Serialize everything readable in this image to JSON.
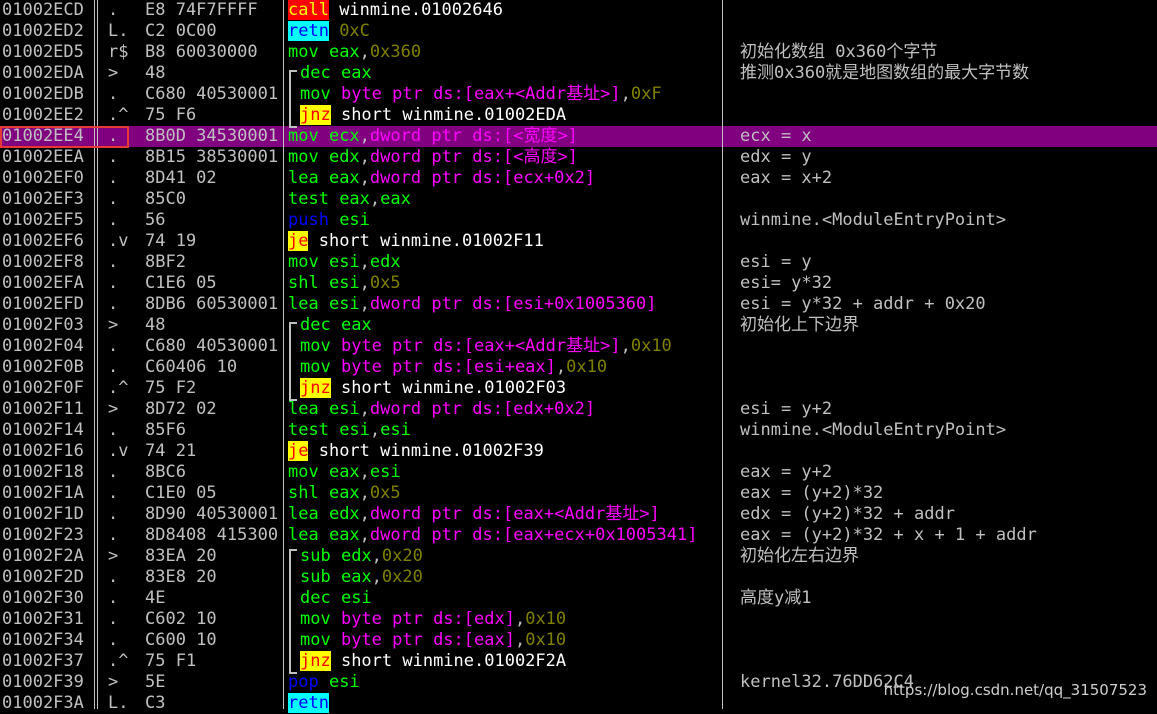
{
  "colors": {
    "default": "#c0c0c0",
    "mnemonic": "#00ff00",
    "operand_reg": "#00ff00",
    "sep": "#c0c0c0",
    "mem": "#ff00ff",
    "imm": "#808000",
    "text": "#ffffff",
    "call_bg": "#ff0000",
    "call_fg": "#ffff00",
    "retn_bg": "#00ffff",
    "retn_fg": "#0000ff",
    "jcc_bg": "#ffff00",
    "jcc_fg": "#ff0000",
    "stack_fg": "#0000ff",
    "selected_bg": "#800080",
    "selected_box": "#e53935"
  },
  "rows": [
    {
      "addr": "01002ECD",
      "flow": ".",
      "hex": "E8 74F7FFFF",
      "asm": [
        {
          "t": "call",
          "s": "call"
        },
        {
          "t": " winmine.01002646",
          "s": "text"
        }
      ],
      "cmt": ""
    },
    {
      "addr": "01002ED2",
      "flow": "L.",
      "hex": "C2 0C00",
      "asm": [
        {
          "t": "retn",
          "s": "retn"
        },
        {
          "t": " 0xC",
          "s": "imm"
        }
      ],
      "cmt": ""
    },
    {
      "addr": "01002ED5",
      "flow": "r$",
      "hex": "B8 60030000",
      "asm": [
        {
          "t": "mov ",
          "s": "mn"
        },
        {
          "t": "eax",
          "s": "reg"
        },
        {
          "t": ",",
          "s": "sep"
        },
        {
          "t": "0x360",
          "s": "imm"
        }
      ],
      "cmt": "初始化数组 0x360个字节"
    },
    {
      "addr": "01002EDA",
      "flow": ">",
      "hex": "48",
      "asm": [
        {
          "t": "dec ",
          "s": "mn"
        },
        {
          "t": "eax",
          "s": "reg"
        }
      ],
      "cmt": "推测0x360就是地图数组的最大字节数"
    },
    {
      "addr": "01002EDB",
      "flow": ".",
      "hex": "C680 40530001",
      "asm": [
        {
          "t": "mov ",
          "s": "mn"
        },
        {
          "t": "byte ptr ds:[eax+<Addr基址>]",
          "s": "mem"
        },
        {
          "t": ",",
          "s": "sep"
        },
        {
          "t": "0xF",
          "s": "imm"
        }
      ],
      "cmt": ""
    },
    {
      "addr": "01002EE2",
      "flow": ".^",
      "hex": "75 F6",
      "asm": [
        {
          "t": "jnz",
          "s": "jcc"
        },
        {
          "t": " short winmine.01002EDA",
          "s": "text"
        }
      ],
      "cmt": ""
    },
    {
      "addr": "01002EE4",
      "flow": ".",
      "hex": "8B0D 34530001",
      "asm": [
        {
          "t": "mov ",
          "s": "mn"
        },
        {
          "t": "ecx",
          "s": "reg"
        },
        {
          "t": ",",
          "s": "sep"
        },
        {
          "t": "dword ptr ds:[<宽度>]",
          "s": "mem"
        }
      ],
      "cmt": "ecx = x",
      "selected": true
    },
    {
      "addr": "01002EEA",
      "flow": ".",
      "hex": "8B15 38530001",
      "asm": [
        {
          "t": "mov ",
          "s": "mn"
        },
        {
          "t": "edx",
          "s": "reg"
        },
        {
          "t": ",",
          "s": "sep"
        },
        {
          "t": "dword ptr ds:[<高度>]",
          "s": "mem"
        }
      ],
      "cmt": "edx = y"
    },
    {
      "addr": "01002EF0",
      "flow": ".",
      "hex": "8D41 02",
      "asm": [
        {
          "t": "lea ",
          "s": "mn"
        },
        {
          "t": "eax",
          "s": "reg"
        },
        {
          "t": ",",
          "s": "sep"
        },
        {
          "t": "dword ptr ds:[ecx+0x2]",
          "s": "mem"
        }
      ],
      "cmt": "eax = x+2"
    },
    {
      "addr": "01002EF3",
      "flow": ".",
      "hex": "85C0",
      "asm": [
        {
          "t": "test ",
          "s": "mn"
        },
        {
          "t": "eax",
          "s": "reg"
        },
        {
          "t": ",",
          "s": "sep"
        },
        {
          "t": "eax",
          "s": "reg"
        }
      ],
      "cmt": ""
    },
    {
      "addr": "01002EF5",
      "flow": ".",
      "hex": "56",
      "asm": [
        {
          "t": "push",
          "s": "stack"
        },
        {
          "t": " esi",
          "s": "reg"
        }
      ],
      "cmt": "winmine.<ModuleEntryPoint>"
    },
    {
      "addr": "01002EF6",
      "flow": ".v",
      "hex": "74 19",
      "asm": [
        {
          "t": "je",
          "s": "jcc"
        },
        {
          "t": " short winmine.01002F11",
          "s": "text"
        }
      ],
      "cmt": ""
    },
    {
      "addr": "01002EF8",
      "flow": ".",
      "hex": "8BF2",
      "asm": [
        {
          "t": "mov ",
          "s": "mn"
        },
        {
          "t": "esi",
          "s": "reg"
        },
        {
          "t": ",",
          "s": "sep"
        },
        {
          "t": "edx",
          "s": "reg"
        }
      ],
      "cmt": "esi = y"
    },
    {
      "addr": "01002EFA",
      "flow": ".",
      "hex": "C1E6 05",
      "asm": [
        {
          "t": "shl ",
          "s": "mn"
        },
        {
          "t": "esi",
          "s": "reg"
        },
        {
          "t": ",",
          "s": "sep"
        },
        {
          "t": "0x5",
          "s": "imm"
        }
      ],
      "cmt": "esi= y*32"
    },
    {
      "addr": "01002EFD",
      "flow": ".",
      "hex": "8DB6 60530001",
      "asm": [
        {
          "t": "lea ",
          "s": "mn"
        },
        {
          "t": "esi",
          "s": "reg"
        },
        {
          "t": ",",
          "s": "sep"
        },
        {
          "t": "dword ptr ds:[esi+0x1005360]",
          "s": "mem"
        }
      ],
      "cmt": "esi = y*32 + addr + 0x20"
    },
    {
      "addr": "01002F03",
      "flow": ">",
      "hex": "48",
      "asm": [
        {
          "t": "dec ",
          "s": "mn"
        },
        {
          "t": "eax",
          "s": "reg"
        }
      ],
      "cmt": "初始化上下边界"
    },
    {
      "addr": "01002F04",
      "flow": ".",
      "hex": "C680 40530001",
      "asm": [
        {
          "t": "mov ",
          "s": "mn"
        },
        {
          "t": "byte ptr ds:[eax+<Addr基址>]",
          "s": "mem"
        },
        {
          "t": ",",
          "s": "sep"
        },
        {
          "t": "0x10",
          "s": "imm"
        }
      ],
      "cmt": ""
    },
    {
      "addr": "01002F0B",
      "flow": ".",
      "hex": "C60406 10",
      "asm": [
        {
          "t": "mov ",
          "s": "mn"
        },
        {
          "t": "byte ptr ds:[esi+eax]",
          "s": "mem"
        },
        {
          "t": ",",
          "s": "sep"
        },
        {
          "t": "0x10",
          "s": "imm"
        }
      ],
      "cmt": ""
    },
    {
      "addr": "01002F0F",
      "flow": ".^",
      "hex": "75 F2",
      "asm": [
        {
          "t": "jnz",
          "s": "jcc"
        },
        {
          "t": " short winmine.01002F03",
          "s": "text"
        }
      ],
      "cmt": ""
    },
    {
      "addr": "01002F11",
      "flow": ">",
      "hex": "8D72 02",
      "asm": [
        {
          "t": "lea ",
          "s": "mn"
        },
        {
          "t": "esi",
          "s": "reg"
        },
        {
          "t": ",",
          "s": "sep"
        },
        {
          "t": "dword ptr ds:[edx+0x2]",
          "s": "mem"
        }
      ],
      "cmt": "esi = y+2"
    },
    {
      "addr": "01002F14",
      "flow": ".",
      "hex": "85F6",
      "asm": [
        {
          "t": "test ",
          "s": "mn"
        },
        {
          "t": "esi",
          "s": "reg"
        },
        {
          "t": ",",
          "s": "sep"
        },
        {
          "t": "esi",
          "s": "reg"
        }
      ],
      "cmt": "winmine.<ModuleEntryPoint>"
    },
    {
      "addr": "01002F16",
      "flow": ".v",
      "hex": "74 21",
      "asm": [
        {
          "t": "je",
          "s": "jcc"
        },
        {
          "t": " short winmine.01002F39",
          "s": "text"
        }
      ],
      "cmt": ""
    },
    {
      "addr": "01002F18",
      "flow": ".",
      "hex": "8BC6",
      "asm": [
        {
          "t": "mov ",
          "s": "mn"
        },
        {
          "t": "eax",
          "s": "reg"
        },
        {
          "t": ",",
          "s": "sep"
        },
        {
          "t": "esi",
          "s": "reg"
        }
      ],
      "cmt": "eax = y+2"
    },
    {
      "addr": "01002F1A",
      "flow": ".",
      "hex": "C1E0 05",
      "asm": [
        {
          "t": "shl ",
          "s": "mn"
        },
        {
          "t": "eax",
          "s": "reg"
        },
        {
          "t": ",",
          "s": "sep"
        },
        {
          "t": "0x5",
          "s": "imm"
        }
      ],
      "cmt": "eax = (y+2)*32"
    },
    {
      "addr": "01002F1D",
      "flow": ".",
      "hex": "8D90 40530001",
      "asm": [
        {
          "t": "lea ",
          "s": "mn"
        },
        {
          "t": "edx",
          "s": "reg"
        },
        {
          "t": ",",
          "s": "sep"
        },
        {
          "t": "dword ptr ds:[eax+<Addr基址>]",
          "s": "mem"
        }
      ],
      "cmt": "edx = (y+2)*32 + addr"
    },
    {
      "addr": "01002F23",
      "flow": ".",
      "hex": "8D8408 415300",
      "asm": [
        {
          "t": "lea ",
          "s": "mn"
        },
        {
          "t": "eax",
          "s": "reg"
        },
        {
          "t": ",",
          "s": "sep"
        },
        {
          "t": "dword ptr ds:[eax+ecx+0x1005341]",
          "s": "mem"
        }
      ],
      "cmt": "eax = (y+2)*32 + x + 1 + addr"
    },
    {
      "addr": "01002F2A",
      "flow": ">",
      "hex": "83EA 20",
      "asm": [
        {
          "t": "sub ",
          "s": "mn"
        },
        {
          "t": "edx",
          "s": "reg"
        },
        {
          "t": ",",
          "s": "sep"
        },
        {
          "t": "0x20",
          "s": "imm"
        }
      ],
      "cmt": "初始化左右边界"
    },
    {
      "addr": "01002F2D",
      "flow": ".",
      "hex": "83E8 20",
      "asm": [
        {
          "t": "sub ",
          "s": "mn"
        },
        {
          "t": "eax",
          "s": "reg"
        },
        {
          "t": ",",
          "s": "sep"
        },
        {
          "t": "0x20",
          "s": "imm"
        }
      ],
      "cmt": ""
    },
    {
      "addr": "01002F30",
      "flow": ".",
      "hex": "4E",
      "asm": [
        {
          "t": "dec ",
          "s": "mn"
        },
        {
          "t": "esi",
          "s": "reg"
        }
      ],
      "cmt": "高度y减1"
    },
    {
      "addr": "01002F31",
      "flow": ".",
      "hex": "C602 10",
      "asm": [
        {
          "t": "mov ",
          "s": "mn"
        },
        {
          "t": "byte ptr ds:[edx]",
          "s": "mem"
        },
        {
          "t": ",",
          "s": "sep"
        },
        {
          "t": "0x10",
          "s": "imm"
        }
      ],
      "cmt": ""
    },
    {
      "addr": "01002F34",
      "flow": ".",
      "hex": "C600 10",
      "asm": [
        {
          "t": "mov ",
          "s": "mn"
        },
        {
          "t": "byte ptr ds:[eax]",
          "s": "mem"
        },
        {
          "t": ",",
          "s": "sep"
        },
        {
          "t": "0x10",
          "s": "imm"
        }
      ],
      "cmt": ""
    },
    {
      "addr": "01002F37",
      "flow": ".^",
      "hex": "75 F1",
      "asm": [
        {
          "t": "jnz",
          "s": "jcc"
        },
        {
          "t": " short winmine.01002F2A",
          "s": "text"
        }
      ],
      "cmt": ""
    },
    {
      "addr": "01002F39",
      "flow": ">",
      "hex": "5E",
      "asm": [
        {
          "t": "pop",
          "s": "stack"
        },
        {
          "t": " esi",
          "s": "reg"
        }
      ],
      "cmt": "kernel32.76DD62C4"
    },
    {
      "addr": "01002F3A",
      "flow": "L.",
      "hex": "C3",
      "asm": [
        {
          "t": "retn",
          "s": "retn"
        }
      ],
      "cmt": ""
    }
  ],
  "watermark": "https://blog.csdn.net/qq_31507523"
}
